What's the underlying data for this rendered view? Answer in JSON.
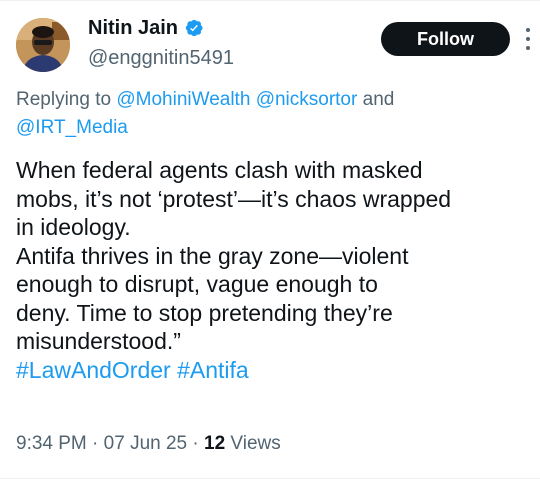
{
  "author": {
    "display_name": "Nitin Jain",
    "handle": "@enggnitin5491",
    "verified": true,
    "avatar_icon": "profile-photo"
  },
  "follow_button": {
    "label": "Follow"
  },
  "more_menu_icon": "more-vertical-icon",
  "reply_context": {
    "prefix": "Replying to ",
    "mentions": [
      "@MohiniWealth",
      "@nicksortor",
      "@IRT_Media"
    ],
    "joiner": " and"
  },
  "tweet": {
    "lines": [
      "When federal agents clash with masked",
      "mobs, it’s not ‘protest’—it’s chaos wrapped",
      "in ideology.",
      "Antifa thrives in the gray zone—violent",
      "enough to disrupt, vague enough to",
      "deny. Time to stop pretending they’re",
      "misunderstood.”"
    ],
    "hashtags": [
      "#LawAndOrder",
      "#Antifa"
    ]
  },
  "meta": {
    "time": "9:34 PM",
    "separator": " · ",
    "date": "07 Jun 25",
    "views_count": "12",
    "views_label": " Views"
  },
  "colors": {
    "link": "#1d9bf0",
    "secondary_text": "#536471",
    "primary_text": "#0f1419",
    "verified_badge": "#1d9bf0"
  }
}
